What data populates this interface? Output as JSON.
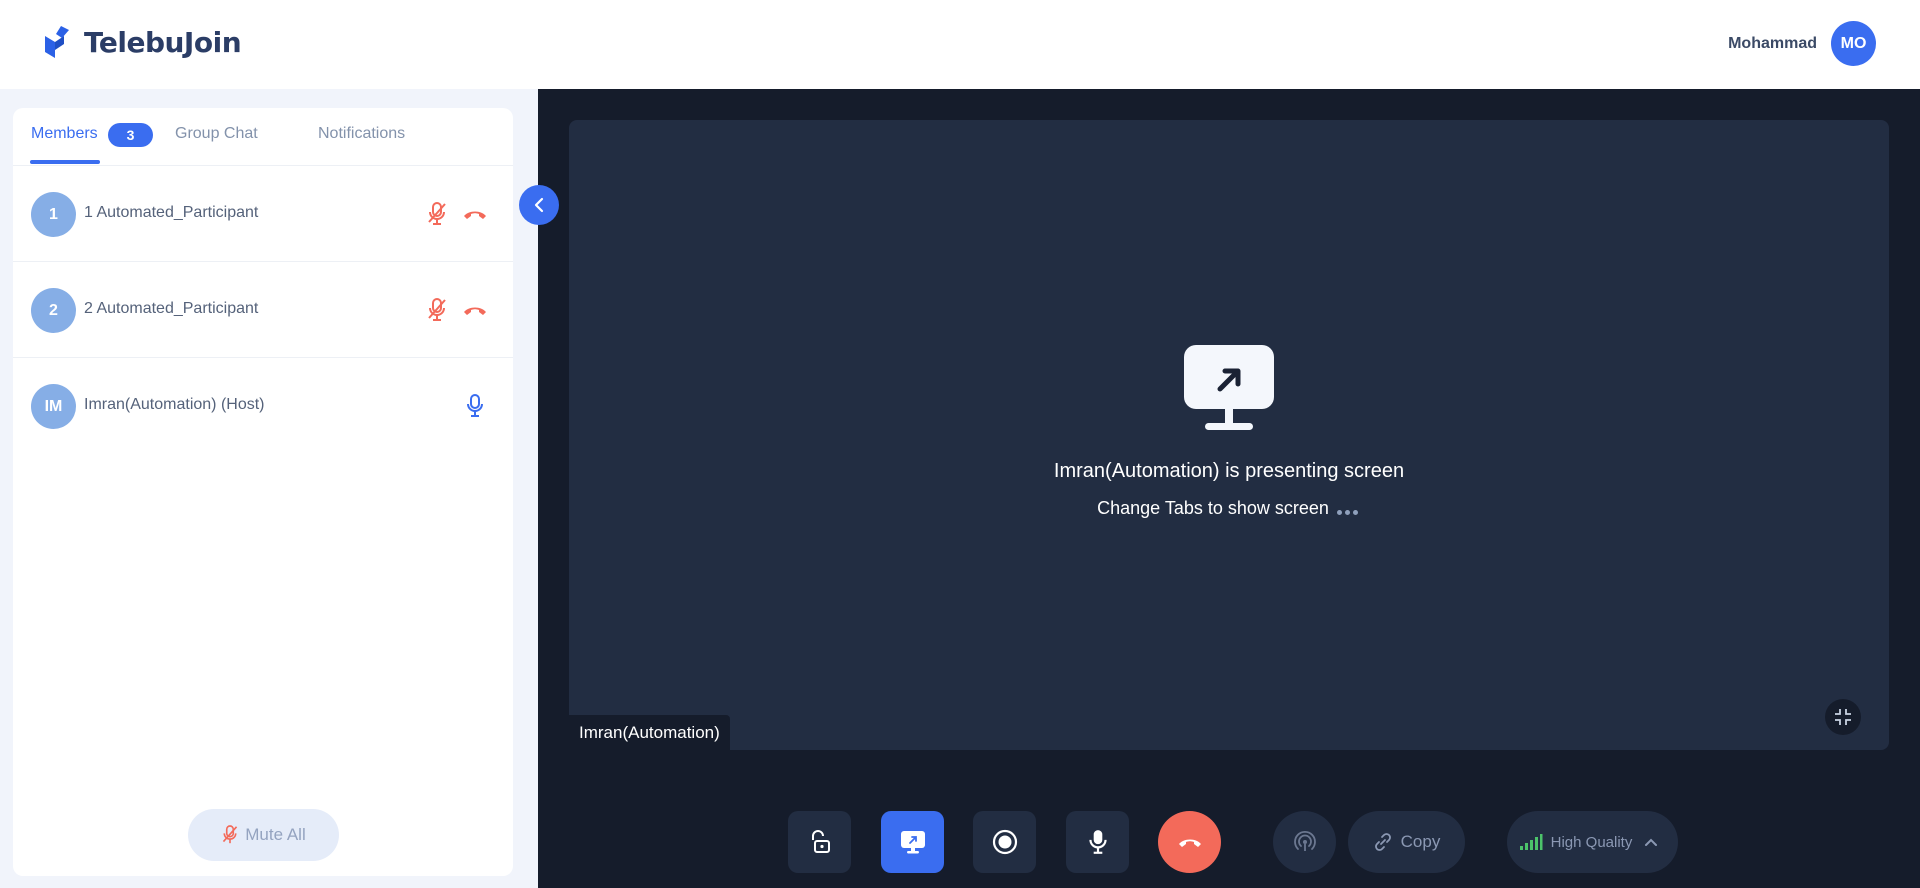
{
  "app": {
    "name": "TelebuJoin",
    "brand_color": "#3a6df0"
  },
  "user": {
    "name": "Mohammad",
    "initials": "MO"
  },
  "sidebar": {
    "tabs": [
      {
        "label": "Members",
        "badge": "3",
        "active": true
      },
      {
        "label": "Group Chat",
        "active": false
      },
      {
        "label": "Notifications",
        "active": false
      }
    ],
    "members": [
      {
        "avatar": "1",
        "name": "1 Automated_Participant",
        "mic": "mic-off-icon",
        "action": "hangup-icon"
      },
      {
        "avatar": "2",
        "name": "2 Automated_Participant",
        "mic": "mic-off-icon",
        "action": "hangup-icon"
      },
      {
        "avatar": "IM",
        "name": "Imran(Automation) (Host)",
        "mic": "mic-on-icon"
      }
    ],
    "mute_all_label": "Mute All"
  },
  "stage": {
    "presenting_title": "Imran(Automation) is presenting screen",
    "presenting_subtitle": "Change Tabs to show screen",
    "name_tag": "Imran(Automation)"
  },
  "controls": {
    "buttons": [
      {
        "name": "unlock-icon"
      },
      {
        "name": "screen-share-icon",
        "active": true
      },
      {
        "name": "record-icon"
      },
      {
        "name": "mic-icon"
      },
      {
        "name": "end-call-icon"
      },
      {
        "name": "broadcast-icon"
      }
    ],
    "copy_label": "Copy",
    "quality_label": "High Quality"
  }
}
